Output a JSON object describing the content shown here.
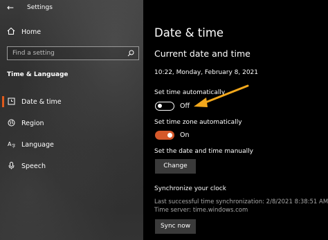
{
  "window": {
    "title": "Settings"
  },
  "sidebar": {
    "home_label": "Home",
    "search_placeholder": "Find a setting",
    "section_title": "Time & Language",
    "items": [
      {
        "label": "Date & time",
        "icon": "clock-icon",
        "active": true
      },
      {
        "label": "Region",
        "icon": "globe-icon",
        "active": false
      },
      {
        "label": "Language",
        "icon": "language-icon",
        "active": false
      },
      {
        "label": "Speech",
        "icon": "microphone-icon",
        "active": false
      }
    ]
  },
  "main": {
    "page_title": "Date & time",
    "section_title": "Current date and time",
    "current_datetime": "10:22, Monday, February 8, 2021",
    "set_time_auto": {
      "label": "Set time automatically",
      "state": "Off",
      "on": false
    },
    "set_tz_auto": {
      "label": "Set time zone automatically",
      "state": "On",
      "on": true
    },
    "manual": {
      "label": "Set the date and time manually",
      "button": "Change"
    },
    "sync": {
      "title": "Synchronize your clock",
      "last_sync": "Last successful time synchronization: 2/8/2021 8:38:51 AM",
      "time_server": "Time server: time.windows.com",
      "button": "Sync now"
    }
  },
  "colors": {
    "accent": "#e05a1c",
    "annotation_arrow": "#f3a81c"
  }
}
